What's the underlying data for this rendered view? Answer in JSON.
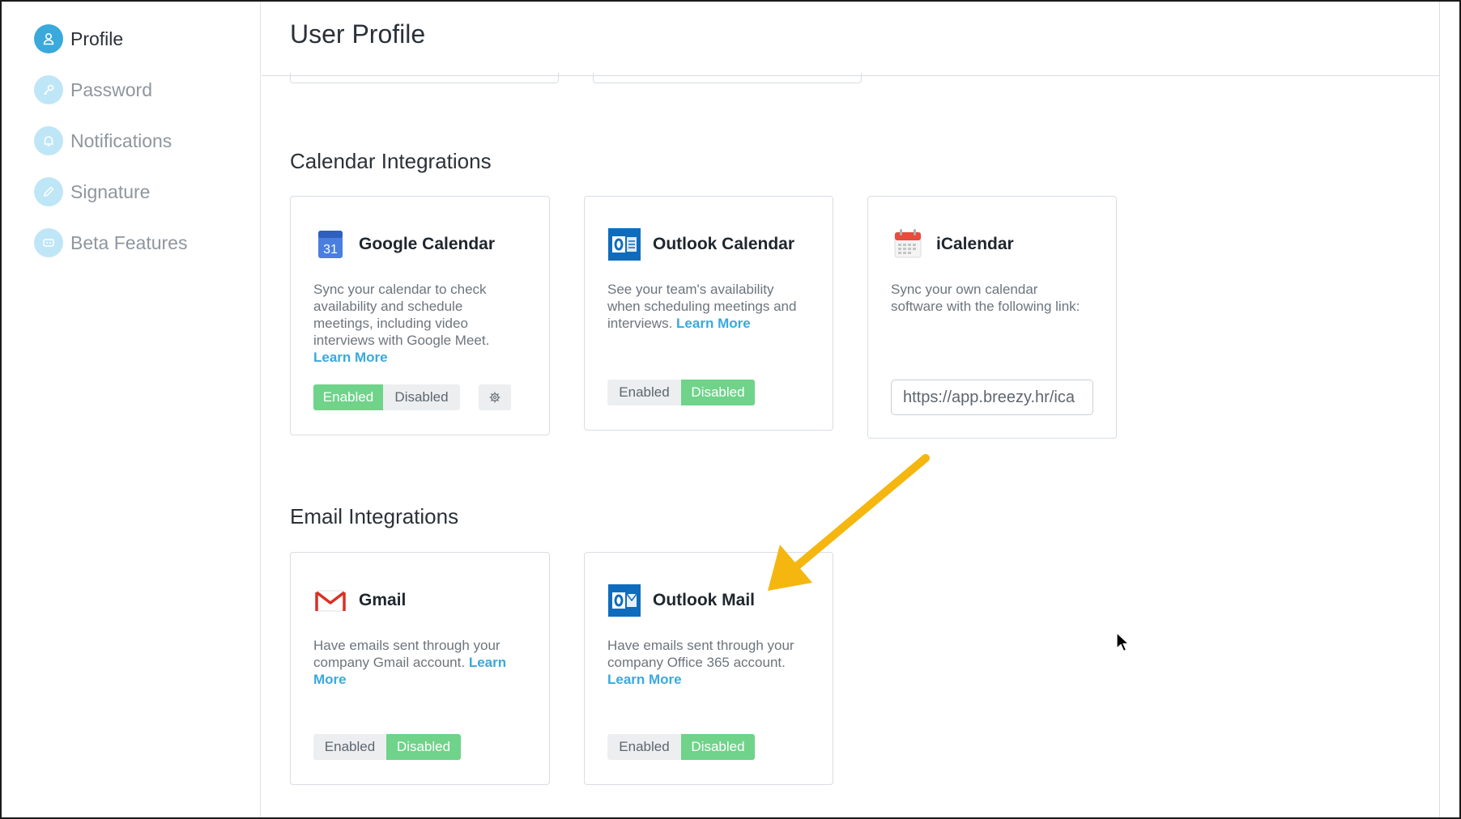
{
  "sidebar": {
    "items": [
      {
        "label": "Profile",
        "icon": "user-icon",
        "active": true
      },
      {
        "label": "Password",
        "icon": "key-icon",
        "active": false
      },
      {
        "label": "Notifications",
        "icon": "bell-icon",
        "active": false
      },
      {
        "label": "Signature",
        "icon": "pencil-icon",
        "active": false
      },
      {
        "label": "Beta Features",
        "icon": "beta-icon",
        "active": false
      }
    ]
  },
  "header": {
    "title": "User Profile"
  },
  "calendar_section": {
    "title": "Calendar Integrations",
    "cards": [
      {
        "title": "Google Calendar",
        "icon": "google-calendar-icon",
        "icon_text": "31",
        "description": "Sync your calendar to check availability and schedule meetings, including video interviews with Google Meet.",
        "link": "Learn More",
        "enabled_label": "Enabled",
        "disabled_label": "Disabled",
        "state": "enabled"
      },
      {
        "title": "Outlook Calendar",
        "icon": "outlook-calendar-icon",
        "description": "See your team's availability when scheduling meetings and interviews.",
        "link": "Learn More",
        "enabled_label": "Enabled",
        "disabled_label": "Disabled",
        "state": "disabled"
      },
      {
        "title": "iCalendar",
        "icon": "icalendar-icon",
        "description": "Sync your own calendar software with the following link:",
        "link_value": "https://app.breezy.hr/ica"
      }
    ]
  },
  "email_section": {
    "title": "Email Integrations",
    "cards": [
      {
        "title": "Gmail",
        "icon": "gmail-icon",
        "description": "Have emails sent through your company Gmail account.",
        "link": "Learn More",
        "enabled_label": "Enabled",
        "disabled_label": "Disabled",
        "state": "disabled"
      },
      {
        "title": "Outlook Mail",
        "icon": "outlook-mail-icon",
        "description": "Have emails sent through your company Office 365 account.",
        "link": "Learn More",
        "enabled_label": "Enabled",
        "disabled_label": "Disabled",
        "state": "disabled"
      }
    ]
  },
  "colors": {
    "accent": "#3aa9dc",
    "enabled_green": "#6fd38a",
    "annotation_arrow": "#f5b60f"
  }
}
